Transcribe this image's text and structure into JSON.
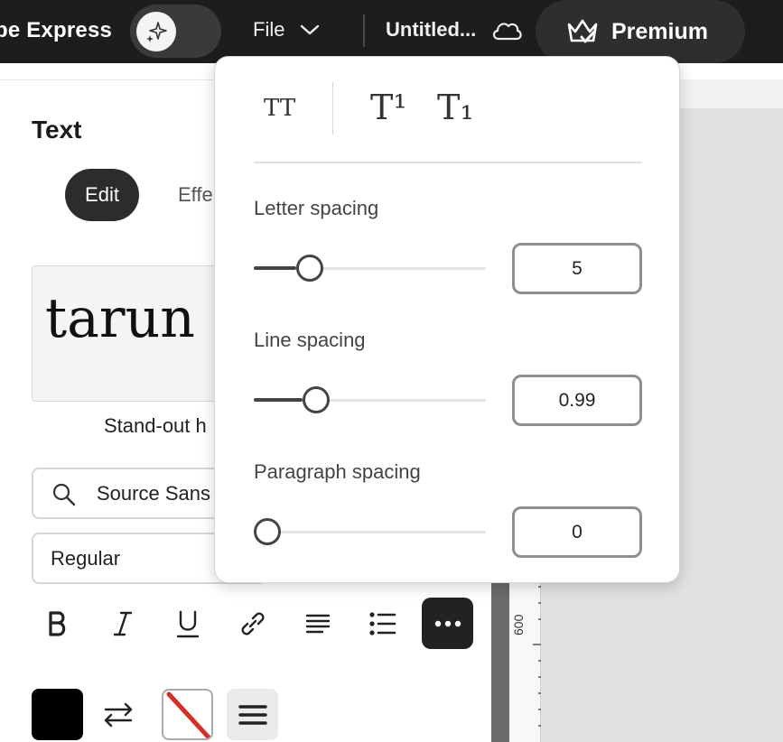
{
  "topbar": {
    "brand": "be Express",
    "file_label": "File",
    "doc_title": "Untitled...",
    "premium_label": "Premium"
  },
  "panel": {
    "title": "Text",
    "tabs": [
      {
        "label": "Edit",
        "active": true
      },
      {
        "label": "Effe",
        "active": false
      }
    ],
    "preview_text": "tarun",
    "preview_caption": "Stand-out h",
    "font_family_value": "Source Sans",
    "font_weight_value": "Regular",
    "format_buttons": [
      "bold-icon",
      "italic-icon",
      "underline-icon",
      "link-icon",
      "align-left-icon",
      "bullet-list-icon",
      "more-icon"
    ],
    "text_color": "#000000"
  },
  "canvas": {
    "ruler_label": "600"
  },
  "spacing_popover": {
    "case_buttons": [
      "TT",
      "T¹",
      "T₁"
    ],
    "letter_spacing": {
      "label": "Letter spacing",
      "value": "5",
      "level": 0.24
    },
    "line_spacing": {
      "label": "Line spacing",
      "value": "0.99",
      "level": 0.27
    },
    "paragraph_spacing": {
      "label": "Paragraph spacing",
      "value": "0",
      "level": 0.0
    }
  },
  "colors": {
    "topbar_bg": "#1d1d1d",
    "accent_dark": "#222222",
    "no_fill_slash": "#d3302a"
  }
}
